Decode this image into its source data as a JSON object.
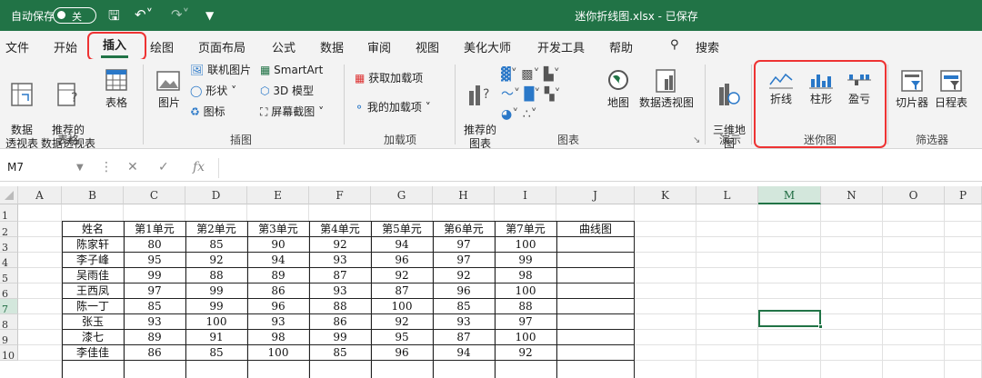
{
  "titlebar": {
    "autosave_label": "自动保存",
    "toggle_label": "关",
    "doc_title": "迷你折线图.xlsx - 已保存",
    "save_icon": "save-icon",
    "undo_icon": "undo-icon",
    "redo_icon": "redo-icon"
  },
  "menu": {
    "items": [
      "文件",
      "开始",
      "插入",
      "绘图",
      "页面布局",
      "公式",
      "数据",
      "审阅",
      "视图",
      "美化大师",
      "开发工具",
      "帮助"
    ],
    "active": "插入",
    "search": "搜索"
  },
  "ribbon": {
    "tables": {
      "pivot": "数据\n透视表",
      "recommended_pivot": "推荐的\n数据透视表",
      "table": "表格",
      "group": "表格"
    },
    "illustrations": {
      "pictures": "图片",
      "online_pictures": "联机图片",
      "shapes": "形状",
      "icons": "图标",
      "smartart": "SmartArt",
      "model3d": "3D 模型",
      "screenshot": "屏幕截图",
      "group": "插图"
    },
    "addins": {
      "get": "获取加载项",
      "my": "我的加载项",
      "group": "加载项"
    },
    "charts": {
      "recommended": "推荐的\n图表",
      "maps": "地图",
      "pivot_chart": "数据透视图",
      "group": "图表"
    },
    "tours": {
      "map3d": "三维地\n图",
      "group": "演示"
    },
    "sparklines": {
      "line": "折线",
      "column": "柱形",
      "winloss": "盈亏",
      "group": "迷你图"
    },
    "filters": {
      "slicer": "切片器",
      "timeline": "日程表",
      "group": "筛选器"
    }
  },
  "formulabar": {
    "namebox": "M7",
    "fx": "fx",
    "formula": ""
  },
  "sheet": {
    "columns": [
      "A",
      "B",
      "C",
      "D",
      "E",
      "F",
      "G",
      "H",
      "I",
      "J",
      "K",
      "L",
      "M",
      "N",
      "O",
      "P"
    ],
    "selected_column": "M",
    "rows": [
      "1",
      "2",
      "3",
      "4",
      "5",
      "6",
      "7",
      "8",
      "9",
      "10"
    ],
    "selected_row": "7",
    "header": [
      "姓名",
      "第1单元",
      "第2单元",
      "第3单元",
      "第4单元",
      "第5单元",
      "第6单元",
      "第7单元",
      "曲线图"
    ],
    "data": [
      [
        "陈家轩",
        "80",
        "85",
        "90",
        "92",
        "94",
        "97",
        "100"
      ],
      [
        "李子峰",
        "95",
        "92",
        "94",
        "93",
        "96",
        "97",
        "99"
      ],
      [
        "吴雨佳",
        "99",
        "88",
        "89",
        "87",
        "92",
        "92",
        "98"
      ],
      [
        "王西凤",
        "97",
        "99",
        "86",
        "93",
        "87",
        "96",
        "100"
      ],
      [
        "陈一丁",
        "85",
        "99",
        "96",
        "88",
        "100",
        "85",
        "88"
      ],
      [
        "张玉",
        "93",
        "100",
        "93",
        "86",
        "92",
        "93",
        "97"
      ],
      [
        "漆七",
        "89",
        "91",
        "98",
        "99",
        "95",
        "87",
        "100"
      ],
      [
        "李佳佳",
        "86",
        "85",
        "100",
        "85",
        "96",
        "94",
        "92"
      ]
    ]
  }
}
